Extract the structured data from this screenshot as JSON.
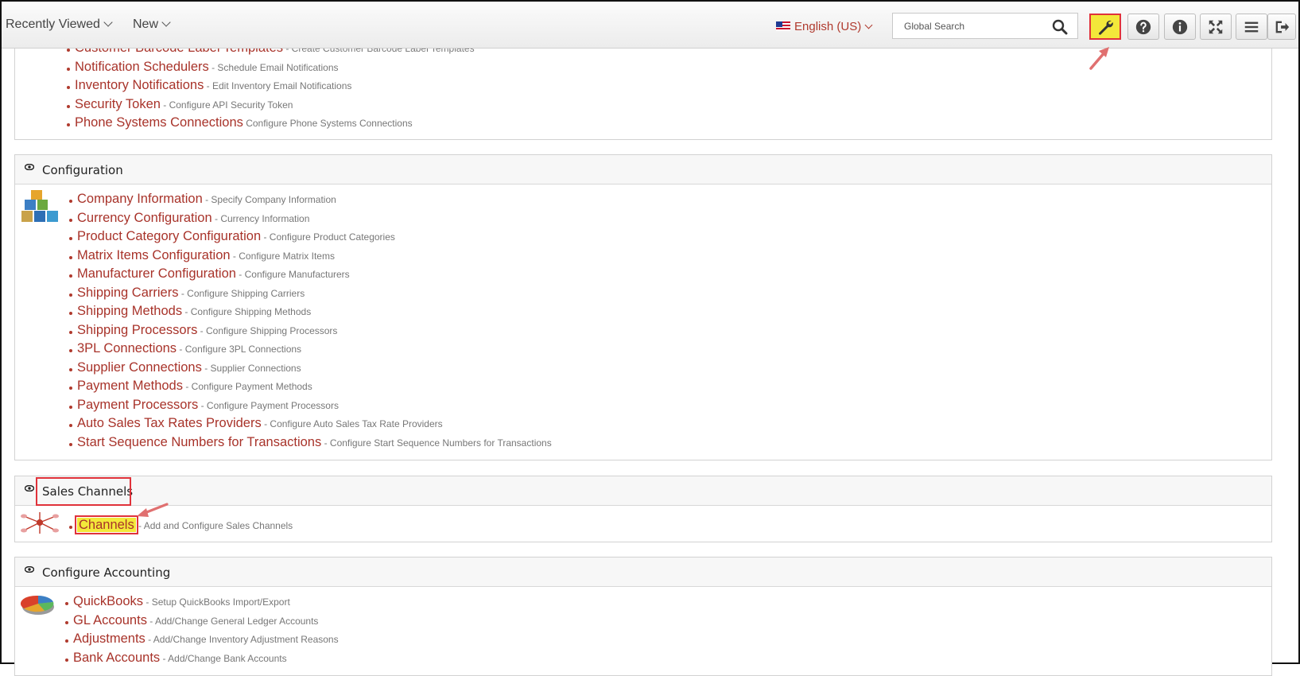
{
  "topbar": {
    "recently_viewed": "Recently Viewed",
    "new": "New",
    "language": "English (US)",
    "search_placeholder": "Global Search",
    "colors": {
      "accent": "#b03a2e",
      "highlight": "#f3e83a",
      "annotation": "#e0323a"
    }
  },
  "panel_top": {
    "items": [
      {
        "label": "Customer Barcode Label Templates",
        "desc": " - Create Customer Barcode Label Templates"
      },
      {
        "label": "Notification Schedulers",
        "desc": " - Schedule Email Notifications"
      },
      {
        "label": "Inventory Notifications",
        "desc": " - Edit Inventory Email Notifications"
      },
      {
        "label": "Security Token",
        "desc": " - Configure API Security Token"
      },
      {
        "label": "Phone Systems Connections",
        "desc": " Configure Phone Systems Connections"
      }
    ]
  },
  "configuration": {
    "title": "Configuration",
    "items": [
      {
        "label": "Company Information",
        "desc": " - Specify Company Information"
      },
      {
        "label": "Currency Configuration",
        "desc": " - Currency Information"
      },
      {
        "label": "Product Category Configuration",
        "desc": " - Configure Product Categories"
      },
      {
        "label": "Matrix Items Configuration",
        "desc": " - Configure Matrix Items"
      },
      {
        "label": "Manufacturer Configuration",
        "desc": " - Configure Manufacturers"
      },
      {
        "label": "Shipping Carriers",
        "desc": " - Configure Shipping Carriers"
      },
      {
        "label": "Shipping Methods",
        "desc": " - Configure Shipping Methods"
      },
      {
        "label": "Shipping Processors",
        "desc": " - Configure Shipping Processors"
      },
      {
        "label": "3PL Connections",
        "desc": " - Configure 3PL Connections"
      },
      {
        "label": "Supplier Connections",
        "desc": " - Supplier Connections"
      },
      {
        "label": "Payment Methods",
        "desc": " - Configure Payment Methods"
      },
      {
        "label": "Payment Processors",
        "desc": " - Configure Payment Processors"
      },
      {
        "label": "Auto Sales Tax Rates Providers",
        "desc": " - Configure Auto Sales Tax Rate Providers"
      },
      {
        "label": "Start Sequence Numbers for Transactions",
        "desc": " - Configure Start Sequence Numbers for Transactions"
      }
    ]
  },
  "sales_channels": {
    "title": "Sales Channels",
    "items": [
      {
        "label": "Channels",
        "desc": " - Add and Configure Sales Channels"
      }
    ]
  },
  "accounting": {
    "title": "Configure Accounting",
    "items": [
      {
        "label": "QuickBooks",
        "desc": " - Setup QuickBooks Import/Export"
      },
      {
        "label": "GL Accounts",
        "desc": " - Add/Change General Ledger Accounts"
      },
      {
        "label": "Adjustments",
        "desc": " - Add/Change Inventory Adjustment Reasons"
      },
      {
        "label": "Bank Accounts",
        "desc": " - Add/Change Bank Accounts"
      }
    ]
  }
}
